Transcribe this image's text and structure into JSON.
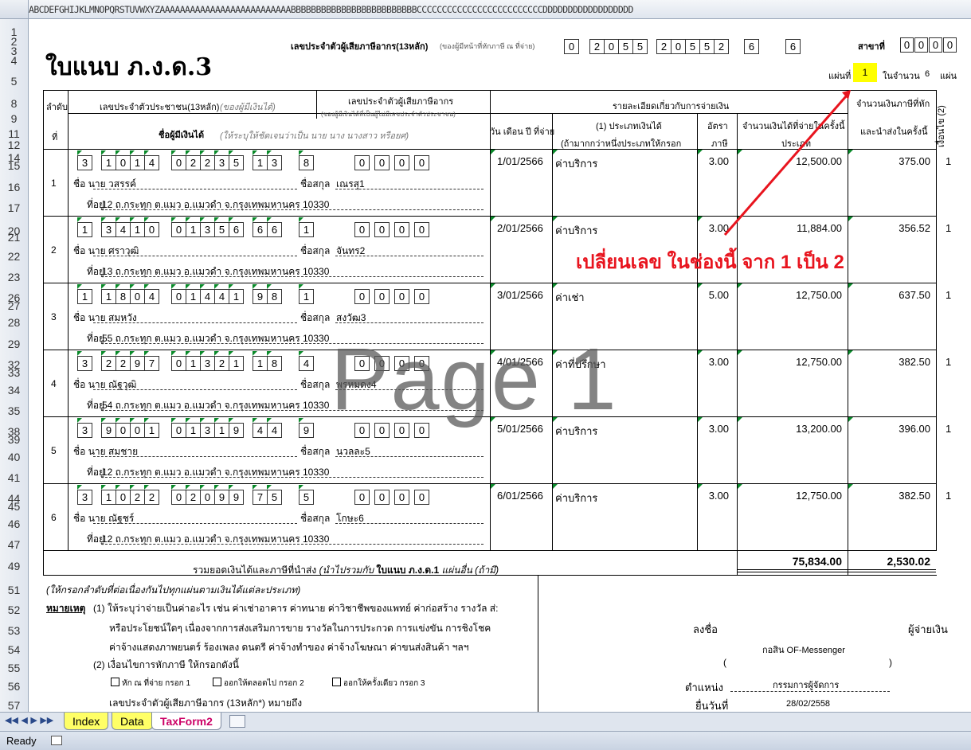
{
  "column_header": "ABCDEFGHIJKLMNOPQRSTUVWXYZAAAAAAAAAAAAAAAAAAAAAAAAAABBBBBBBBBBBBBBBBBBBBBBBBBCCCCCCCCCCCCCCCCCCCCCCCCCDDDDDDDDDDDDDDDDDD",
  "row_numbers": [
    "1",
    "2",
    "3",
    "4",
    "5",
    "8",
    "9",
    "11",
    "12",
    "14",
    "15",
    "16",
    "17",
    "20",
    "21",
    "22",
    "23",
    "26",
    "27",
    "28",
    "29",
    "32",
    "33",
    "34",
    "35",
    "38",
    "39",
    "40",
    "41",
    "44",
    "45",
    "46",
    "47",
    "49",
    "51",
    "52",
    "53",
    "54",
    "55",
    "56",
    "57"
  ],
  "form": {
    "title": "ใบแนบ ภ.ง.ด.3",
    "taxid_label": "เลขประจำตัวผู้เสียภาษีอากร(13หลัก)",
    "taxid_note": "(ของผู้มีหน้าที่หักภาษี ณ ที่จ่าย)",
    "taxid_digits": [
      "0",
      "2",
      "0",
      "5",
      "5",
      "2",
      "0",
      "5",
      "5",
      "2",
      "6",
      "6"
    ],
    "branch_label": "สาขาที่",
    "branch_digits": [
      "0",
      "0",
      "0",
      "0"
    ],
    "sheet_label": "แผ่นที่",
    "sheet_no": "1",
    "of_label": "ในจำนวน",
    "total_sheets": "6",
    "sheet_unit": "แผ่น"
  },
  "header": {
    "seq": "ลำดับ",
    "seq2": "ที่",
    "id_label": "เลขประจำตัวประชาชน(13หลัก)",
    "id_label_note": "(ของผู้มีเงินได้)",
    "taxid_col": "เลขประจำตัวผู้เสียภาษีอากร",
    "taxid_col_note": "(ของผู้มีเงินได้ที่เป็นผู้ไม่มีเลขประจำตัวประชาชน)",
    "name_label": "ชื่อผู้มีเงินได้",
    "name_note": "(ให้ระบุให้ชัดเจนว่าเป็น นาย นาง นางสาว หรือยศ)",
    "detail": "รายละเอียดเกี่ยวกับการจ่ายเงิน",
    "date_col": "วัน เดือน ปี ที่จ่าย",
    "type_col": "(1) ประเภทเงินได้",
    "type_col2": "(ถ้ามากกว่าหนึ่งประเภทให้กรอก",
    "rate_col": "อัตรา",
    "rate_col2": "ภาษี",
    "amount_col": "จำนวนเงินได้ที่จ่ายในครั้งนี้",
    "amount_col2": "ประเภท",
    "tax_col": "จำนวนเงินภาษีที่หัก",
    "tax_col2": "และนำส่งในครั้งนี้",
    "cond_col": "เงื่อนไข (2)"
  },
  "rows": [
    {
      "seq": "1",
      "id": [
        "3",
        "1",
        "0",
        "1",
        "4",
        "0",
        "2",
        "2",
        "3",
        "5",
        "1",
        "3",
        "8"
      ],
      "tid": [
        "0",
        "0",
        "0",
        "0"
      ],
      "prefix": "ชื่อ",
      "title": "นาย",
      "first": "วสรรค์",
      "last_label": "ชื่อสกุล",
      "last": "เณรสุ1",
      "addr_label": "ที่อยู่",
      "addr": "12 ถ.กระทุก ต.แมว อ.แมวดำ จ.กรุงเทพมหานคร 10330",
      "date": "1/01/2566",
      "type": "ค่าบริการ",
      "rate": "3.00",
      "amount": "12,500.00",
      "tax": "375.00",
      "cond": "1"
    },
    {
      "seq": "2",
      "id": [
        "1",
        "3",
        "4",
        "1",
        "0",
        "0",
        "1",
        "3",
        "5",
        "6",
        "6",
        "6",
        "1"
      ],
      "tid": [
        "0",
        "0",
        "0",
        "0"
      ],
      "prefix": "ชื่อ",
      "title": "นาย",
      "first": "ศราวุฒิ",
      "last_label": "ชื่อสกุล",
      "last": "จันทร2",
      "addr_label": "ที่อยู่",
      "addr": "13 ถ.กระทุก ต.แมว อ.แมวดำ จ.กรุงเทพมหานคร 10330",
      "date": "2/01/2566",
      "type": "ค่าบริการ",
      "rate": "3.00",
      "amount": "11,884.00",
      "tax": "356.52",
      "cond": "1"
    },
    {
      "seq": "3",
      "id": [
        "1",
        "1",
        "8",
        "0",
        "4",
        "0",
        "1",
        "4",
        "4",
        "1",
        "9",
        "8",
        "1"
      ],
      "tid": [
        "0",
        "0",
        "0",
        "0"
      ],
      "prefix": "ชื่อ",
      "title": "นาย",
      "first": "สมหวัง",
      "last_label": "ชื่อสกุล",
      "last": "สงวัฒ3",
      "addr_label": "ที่อยู่",
      "addr": "55 ถ.กระทุก ต.แมว อ.แมวดำ จ.กรุงเทพมหานคร 10330",
      "date": "3/01/2566",
      "type": "ค่าเช่า",
      "rate": "5.00",
      "amount": "12,750.00",
      "tax": "637.50",
      "cond": "1"
    },
    {
      "seq": "4",
      "id": [
        "3",
        "2",
        "2",
        "9",
        "7",
        "0",
        "1",
        "3",
        "2",
        "1",
        "1",
        "8",
        "4"
      ],
      "tid": [
        "0",
        "0",
        "0",
        "0"
      ],
      "prefix": "ชื่อ",
      "title": "นาย",
      "first": "ณัฐวุฒิ",
      "last_label": "ชื่อสกุล",
      "last": "พรหมดง4",
      "addr_label": "ที่อยู่",
      "addr": "54 ถ.กระทุก ต.แมว อ.แมวดำ จ.กรุงเทพมหานคร 10330",
      "date": "4/01/2566",
      "type": "ค่าที่ปรึกษา",
      "rate": "3.00",
      "amount": "12,750.00",
      "tax": "382.50",
      "cond": "1"
    },
    {
      "seq": "5",
      "id": [
        "3",
        "9",
        "0",
        "0",
        "1",
        "0",
        "1",
        "3",
        "1",
        "9",
        "4",
        "4",
        "9"
      ],
      "tid": [
        "0",
        "0",
        "0",
        "0"
      ],
      "prefix": "ชื่อ",
      "title": "นาย",
      "first": "สมชาย",
      "last_label": "ชื่อสกุล",
      "last": "นวลละ5",
      "addr_label": "ที่อยู่",
      "addr": "12 ถ.กระทุก ต.แมว อ.แมวดำ จ.กรุงเทพมหานคร 10330",
      "date": "5/01/2566",
      "type": "ค่าบริการ",
      "rate": "3.00",
      "amount": "13,200.00",
      "tax": "396.00",
      "cond": "1"
    },
    {
      "seq": "6",
      "id": [
        "3",
        "1",
        "0",
        "2",
        "2",
        "0",
        "2",
        "0",
        "9",
        "9",
        "7",
        "5",
        "5"
      ],
      "tid": [
        "0",
        "0",
        "0",
        "0"
      ],
      "prefix": "ชื่อ",
      "title": "นาย",
      "first": "ณัฐชร์",
      "last_label": "ชื่อสกุล",
      "last": "โกษะ6",
      "addr_label": "ที่อยู่",
      "addr": "12 ถ.กระทุก ต.แมว อ.แมวดำ จ.กรุงเทพมหานคร 10330",
      "date": "6/01/2566",
      "type": "ค่าบริการ",
      "rate": "3.00",
      "amount": "12,750.00",
      "tax": "382.50",
      "cond": "1"
    }
  ],
  "totals": {
    "label": "รวมยอดเงินได้และภาษีที่นำส่ง",
    "note": "(นำไปรวมกับ",
    "bold": "ใบแนบ ภ.ง.ด.1",
    "note2": "แผ่นอื่น (ถ้ามี)",
    "amount": "75,834.00",
    "tax": "2,530.02"
  },
  "notes": {
    "l1": "(ให้กรอกลำดับที่ต่อเนื่องกันไปทุกแผ่นตามเงินได้แต่ละประเภท)",
    "remark": "หมายเหตุ",
    "n1": "(1) ให้ระบุว่าจ่ายเป็นค่าอะไร เช่น ค่าเช่าอาคาร ค่าทนาย ค่าวิชาชีพของแพทย์ ค่าก่อสร้าง รางวัล ส่:",
    "n2": "หรือประโยชน์ใดๆ เนื่องจากการส่งเสริมการขาย รางวัลในการประกวด การแข่งขัน การชิงโชค",
    "n3": "ค่าจ้างแสดงภาพยนตร์ ร้องเพลง ดนตรี ค่าจ้างทำของ ค่าจ้างโฆษณา ค่าขนส่งสินค้า ฯลฯ",
    "n4": "(2) เงื่อนไขการหักภาษี ให้กรอกดังนี้",
    "c1": "หัก ณ ที่จ่าย  กรอก 1",
    "c2": "ออกให้ตลอดไป  กรอก 2",
    "c3": "ออกให้ครั้งเดียว  กรอก 3",
    "n5": "เลขประจำตัวผู้เสียภาษีอากร (13หลัก*) หมายถึง"
  },
  "signature": {
    "sign": "ลงชื่อ",
    "payer": "ผู้จ่ายเงิน",
    "name": "กอสิน OF-Messenger",
    "open": "(",
    "close": ")",
    "pos_label": "ตำแหน่ง",
    "pos": "กรรมการผู้จัดการ",
    "date_label": "ยื่นวันที่",
    "date": "28/02/2558"
  },
  "annotation": {
    "text": "เปลี่ยนเลข ในช่องนี้ จาก 1 เป็น 2",
    "color": "#e8141e"
  },
  "watermark": "Page 1",
  "tabs": [
    "Index",
    "Data",
    "TaxForm2"
  ],
  "status": "Ready",
  "colors": {
    "highlight": "#ffff00",
    "green_tri": "#0a8a2a",
    "tab_yellow": "#ffff66",
    "tab_active_text": "#cc0066"
  }
}
